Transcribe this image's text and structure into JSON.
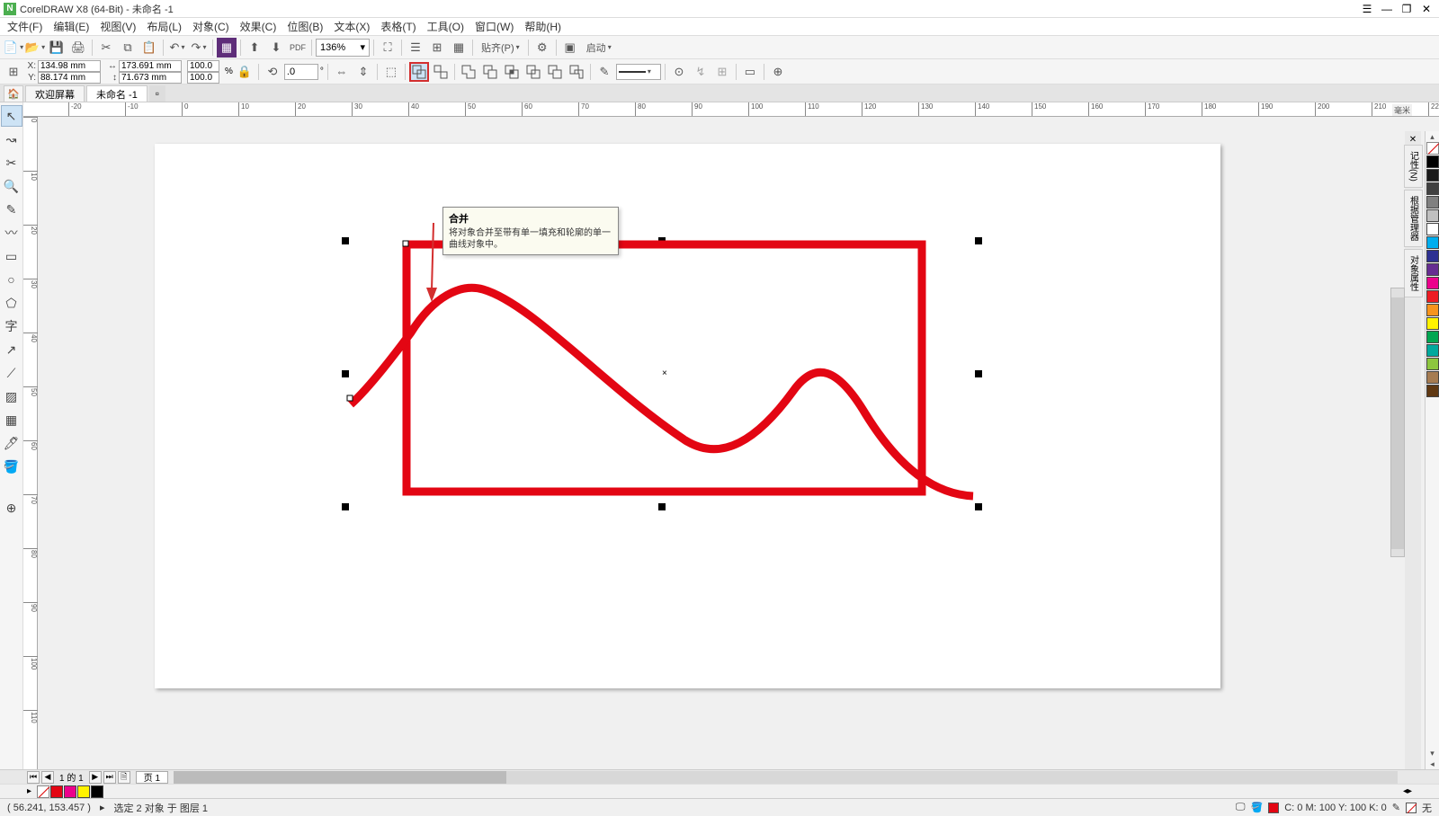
{
  "app": {
    "title": "CorelDRAW X8 (64-Bit) - 未命名 -1",
    "logo_letter": "N"
  },
  "win_controls": {
    "sys": "☰",
    "min": "—",
    "restore": "❐",
    "close": "✕"
  },
  "menu": {
    "file": "文件(F)",
    "edit": "编辑(E)",
    "view": "视图(V)",
    "layout": "布局(L)",
    "object": "对象(C)",
    "effects": "效果(C)",
    "bitmap": "位图(B)",
    "text": "文本(X)",
    "table": "表格(T)",
    "tools": "工具(O)",
    "window": "窗口(W)",
    "help": "帮助(H)"
  },
  "toolbar1": {
    "zoom_value": "136%",
    "paste_label": "贴齐(P)",
    "startup_label": "启动"
  },
  "property_bar": {
    "x_label": "X:",
    "y_label": "Y:",
    "x_value": "134.98 mm",
    "y_value": "88.174 mm",
    "w_value": "173.691 mm",
    "h_value": "71.673 mm",
    "scale_x": "100.0",
    "scale_y": "100.0",
    "rotation": ".0"
  },
  "tooltip": {
    "title": "合并",
    "body": "将对象合并至带有单一填充和轮廓的单一曲线对象中。"
  },
  "tabs": {
    "welcome": "欢迎屏幕",
    "doc1": "未命名 -1"
  },
  "ruler": {
    "unit": "毫米"
  },
  "right_panels": {
    "p1": "记性(N)",
    "p2": "根据管理器",
    "p3": "对象属性"
  },
  "page_nav": {
    "position": "1 的 1",
    "page_tab": "页 1"
  },
  "statusbar": {
    "cursor": "( 56.241, 153.457 )",
    "selection": "选定 2 对象 于 图层 1",
    "color_model": "C: 0 M: 100 Y: 100 K: 0",
    "none_label": "无"
  },
  "colors": {
    "palette": [
      "#000000",
      "#1a1a1a",
      "#404040",
      "#808080",
      "#c0c0c0",
      "#ffffff",
      "#00aeef",
      "#2e3192",
      "#662d91",
      "#ec008c",
      "#ed1c24",
      "#f7941d",
      "#fff200",
      "#00a651",
      "#00a99d",
      "#8dc63f",
      "#a67c52",
      "#603913"
    ]
  }
}
